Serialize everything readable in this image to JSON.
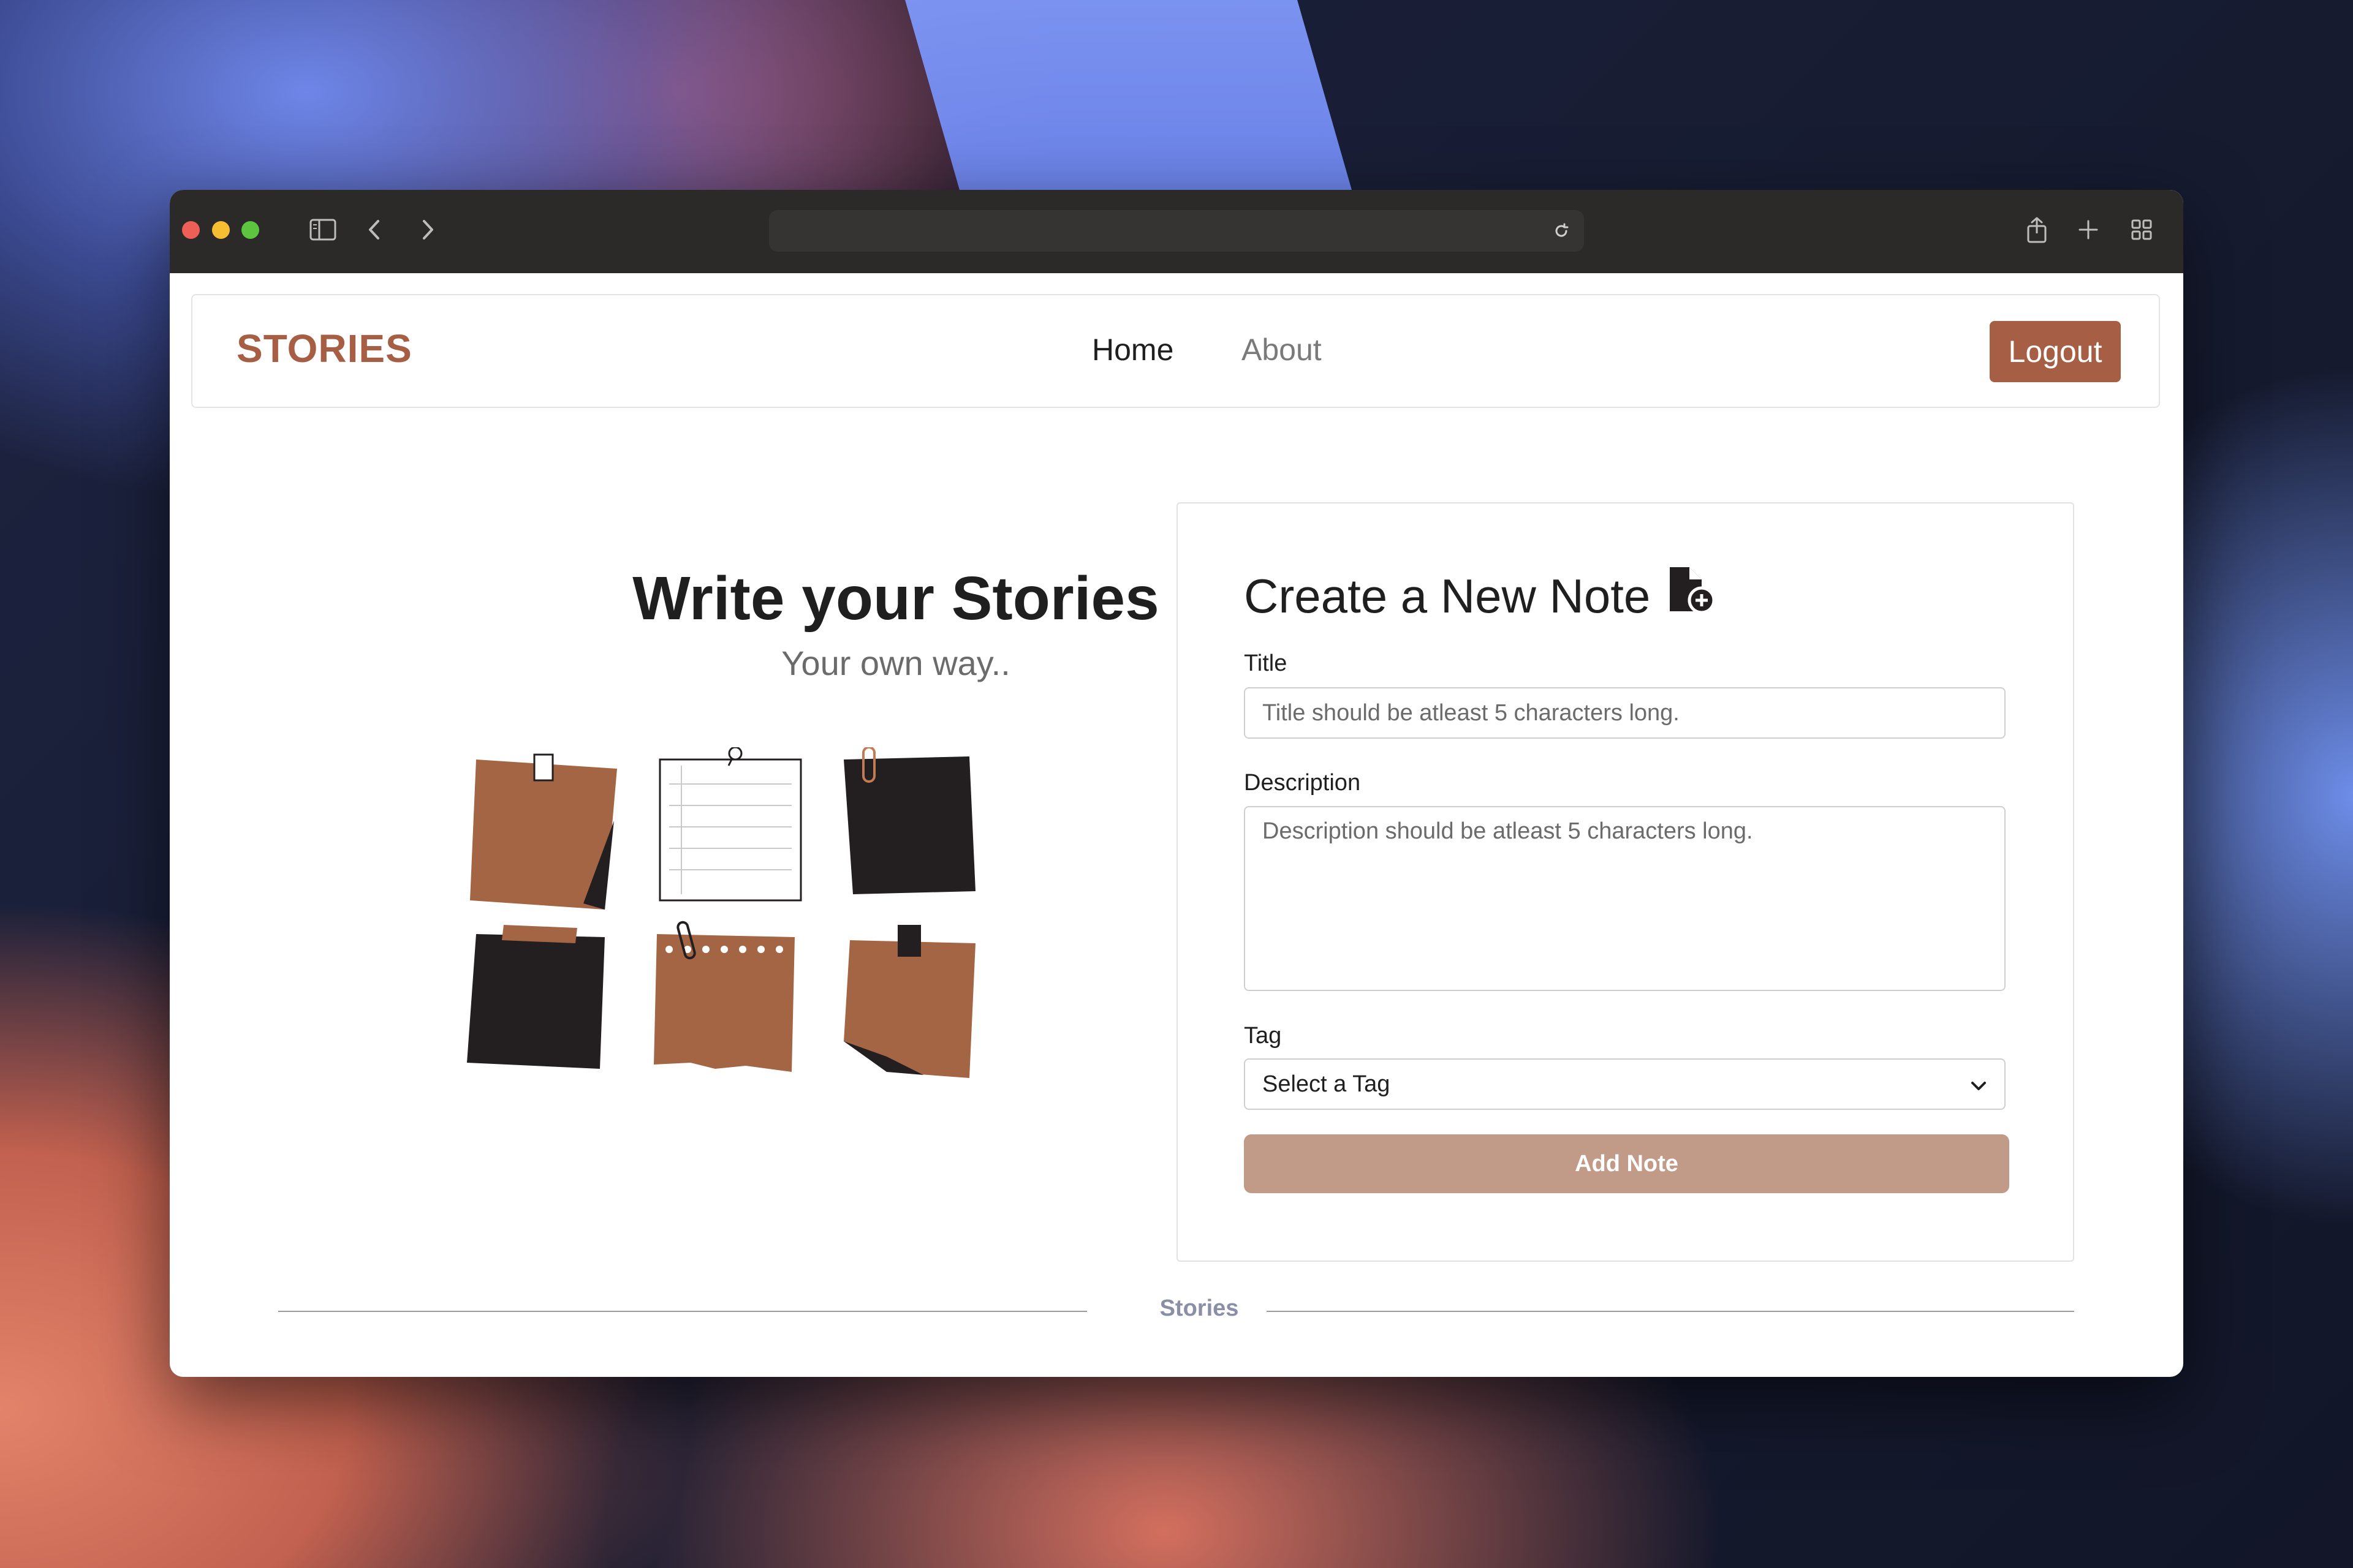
{
  "browser": {
    "icons": [
      "sidebar-icon",
      "back-icon",
      "forward-icon",
      "reload-icon",
      "share-icon",
      "new-tab-icon",
      "tab-overview-icon"
    ]
  },
  "navbar": {
    "brand": "STORIES",
    "links": [
      {
        "label": "Home"
      },
      {
        "label": "About"
      }
    ],
    "logout_label": "Logout"
  },
  "hero": {
    "title": "Write your Stories",
    "subtitle": "Your own way.."
  },
  "form": {
    "title": "Create a New Note",
    "title_icon": "file-plus-icon",
    "title_label": "Title",
    "title_placeholder": "Title should be atleast 5 characters long.",
    "description_label": "Description",
    "description_placeholder": "Description should be atleast 5 characters long.",
    "tag_label": "Tag",
    "tag_selected": "Select a Tag",
    "submit_label": "Add Note"
  },
  "footer": {
    "text": "Stories"
  },
  "colors": {
    "brand": "#a65f44",
    "button_disabled": "#c29a88",
    "dark_note": "#231f20"
  }
}
